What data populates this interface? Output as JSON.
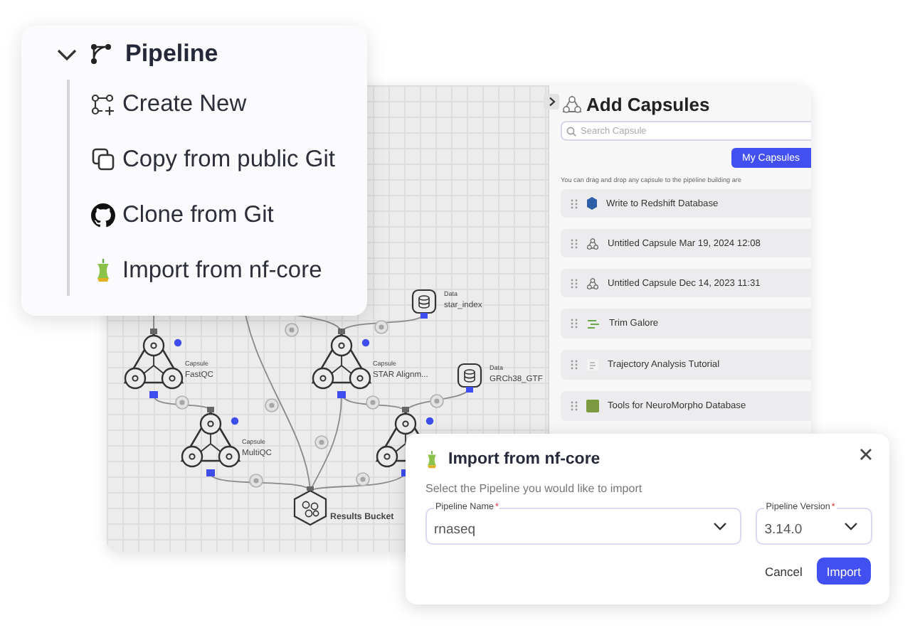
{
  "menu": {
    "title": "Pipeline",
    "expanded": true,
    "items": [
      {
        "kind": "create",
        "label": "Create New"
      },
      {
        "kind": "copy",
        "label": "Copy from public Git"
      },
      {
        "kind": "github",
        "label": "Clone from Git"
      },
      {
        "kind": "nfcore",
        "label": "Import from nf-core"
      }
    ]
  },
  "canvas": {
    "nodes": [
      {
        "kind": "capsule",
        "type_label": "Capsule",
        "name": "FastQC"
      },
      {
        "kind": "capsule",
        "type_label": "Capsule",
        "name": "STAR Alignm..."
      },
      {
        "kind": "capsule",
        "type_label": "Capsule",
        "name": "MultiQC"
      },
      {
        "kind": "capsule"
      },
      {
        "kind": "data",
        "type_label": "Data",
        "name": "star_index"
      },
      {
        "kind": "data",
        "type_label": "Data",
        "name": "GRCh38_GTF"
      },
      {
        "kind": "bucket",
        "name": "Results Bucket"
      }
    ]
  },
  "panel": {
    "title": "Add Capsules",
    "search": {
      "placeholder": "Search Capsule"
    },
    "tab": "My Capsules",
    "hint": "You can drag and drop any capsule to the pipeline building are",
    "items": [
      {
        "kind": "database",
        "label": "Write to Redshift Database"
      },
      {
        "kind": "capsule",
        "label": "Untitled Capsule Mar 19, 2024 12:08"
      },
      {
        "kind": "capsule",
        "label": "Untitled Capsule Dec 14, 2023 11:31"
      },
      {
        "kind": "tool",
        "label": "Trim Galore"
      },
      {
        "kind": "tutorial",
        "label": "Trajectory Analysis Tutorial"
      },
      {
        "kind": "image",
        "label": "Tools for NeuroMorpho Database"
      }
    ]
  },
  "dialog": {
    "title": "Import from nf-core",
    "description": "Select the Pipeline you would like to import",
    "fields": [
      {
        "label": "Pipeline Name",
        "required_mark": "*",
        "value": "rnaseq"
      },
      {
        "label": "Pipeline Version",
        "required_mark": "*",
        "value": "3.14.0"
      }
    ],
    "buttons": [
      {
        "kind": "text",
        "label": "Cancel"
      },
      {
        "kind": "primary",
        "label": "Import"
      }
    ]
  }
}
